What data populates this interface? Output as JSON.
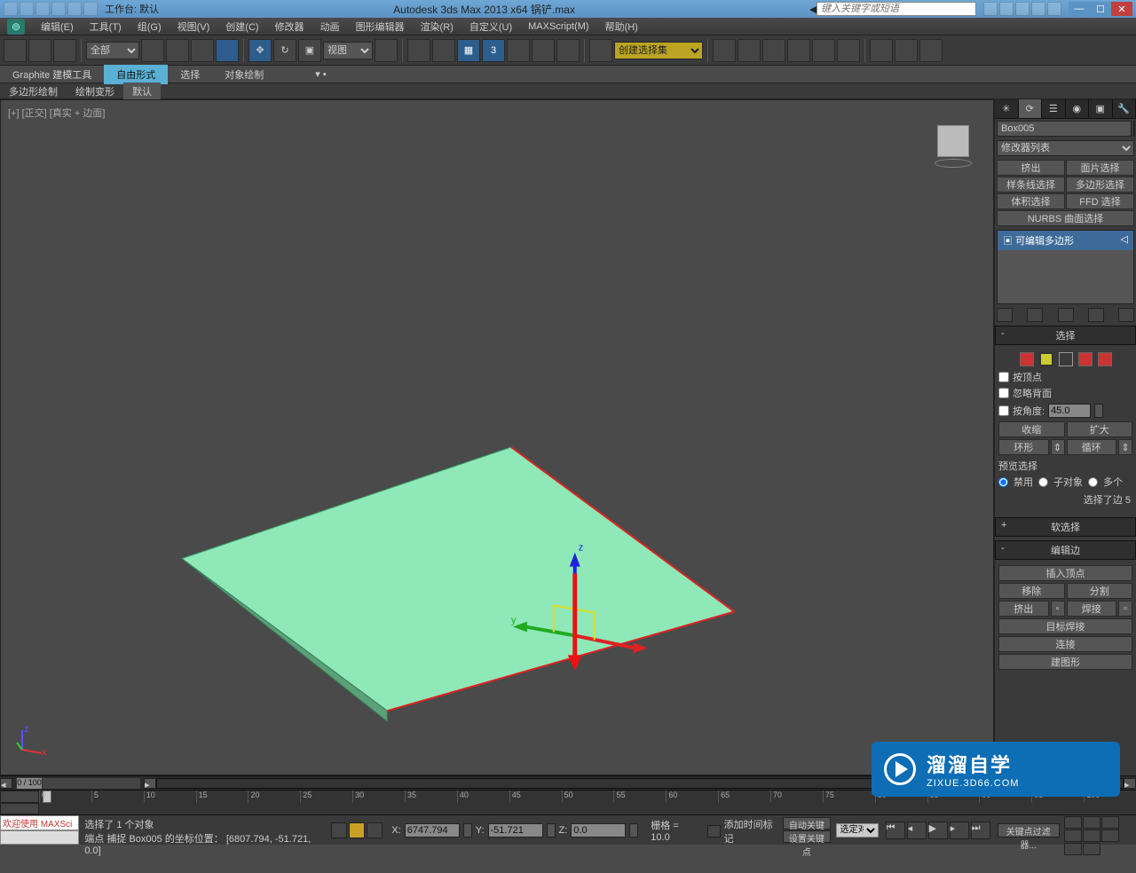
{
  "titlebar": {
    "workspace_label": "工作台: 默认",
    "app_title": "Autodesk 3ds Max  2013 x64     锅铲.max",
    "search_placeholder": "键入关键字或短语"
  },
  "menu": {
    "items": [
      "编辑(E)",
      "工具(T)",
      "组(G)",
      "视图(V)",
      "创建(C)",
      "修改器",
      "动画",
      "图形编辑器",
      "渲染(R)",
      "自定义(U)",
      "MAXScript(M)",
      "帮助(H)"
    ]
  },
  "toolbar": {
    "filter_all": "全部",
    "view_dd": "视图",
    "snap_3": "3",
    "select_set_placeholder": "创建选择集"
  },
  "ribbon": {
    "tabs": [
      "Graphite 建模工具",
      "自由形式",
      "选择",
      "对象绘制"
    ],
    "subtabs": [
      "多边形绘制",
      "绘制变形",
      "默认"
    ]
  },
  "viewport": {
    "label": "[+] [正交] [真实 + 边面]"
  },
  "command_panel": {
    "object_name": "Box005",
    "modifier_dd": "修改器列表",
    "mod_buttons": [
      "挤出",
      "面片选择",
      "样条线选择",
      "多边形选择",
      "体积选择",
      "FFD 选择",
      "NURBS 曲面选择"
    ],
    "stack_item": "可编辑多边形",
    "rollouts": {
      "selection": {
        "title": "选择",
        "by_vertex": "按顶点",
        "ignore_backface": "忽略背面",
        "by_angle": "按角度:",
        "angle_value": "45.0",
        "shrink": "收缩",
        "grow": "扩大",
        "ring": "环形",
        "loop": "循环",
        "preview_label": "预览选择",
        "preview_opts": [
          "禁用",
          "子对象",
          "多个"
        ],
        "info": "选择了边 5"
      },
      "soft_sel": {
        "title": "软选择"
      },
      "edit_edge": {
        "title": "编辑边",
        "insert_vertex": "插入顶点",
        "remove": "移除",
        "split": "分割",
        "extrude": "挤出",
        "weld": "焊接",
        "target_weld": "目标焊接",
        "chamfer_like": "连接",
        "create_shape": "建图形"
      }
    }
  },
  "timeline": {
    "frame_label": "0 / 100",
    "ticks": [
      "0",
      "5",
      "10",
      "15",
      "20",
      "25",
      "30",
      "35",
      "40",
      "45",
      "50",
      "55",
      "60",
      "65",
      "70",
      "75",
      "80",
      "85",
      "90",
      "95",
      "100"
    ]
  },
  "status": {
    "welcome": "欢迎使用  MAXSci",
    "line1": "选择了 1 个对象",
    "line2": "端点 捕捉 Box005 的坐标位置：  [6807.794, -51.721, 0.0]",
    "x_label": "X:",
    "x_value": "6747.794",
    "y_label": "Y:",
    "y_value": "-51.721",
    "z_label": "Z:",
    "z_value": "0.0",
    "grid": "栅格 = 10.0",
    "add_time_tag": "添加时间标记",
    "autokey": "自动关键点",
    "setkey": "设置关键点",
    "keyfilter_dd": "选定对象",
    "keyfilter_btn": "关键点过滤器..."
  },
  "watermark": {
    "brand": "溜溜自学",
    "url": "ZIXUE.3D66.COM"
  }
}
